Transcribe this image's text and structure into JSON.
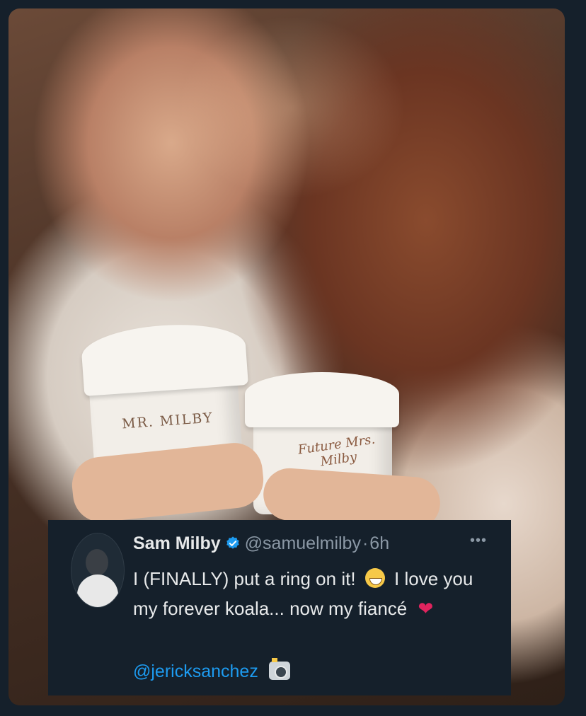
{
  "photo": {
    "cup_left_text": "MR. MILBY",
    "cup_right_text": "Future Mrs. Milby"
  },
  "tweet": {
    "author_name": "Sam Milby",
    "author_handle": "@samuelmilby",
    "separator": "·",
    "time": "6h",
    "more_label": "•••",
    "text_part1": "I (FINALLY) put a ring on it!",
    "text_part2": "I love you my forever koala... now my fiancé",
    "mention": "@jericksanchez",
    "colors": {
      "background": "#15202b",
      "link": "#1d9bf0",
      "verified": "#1d9bf0",
      "secondary_text": "#8b98a5"
    },
    "icons": {
      "verified": "verified-badge-icon",
      "grin": "grinning-face-emoji-icon",
      "heart": "red-heart-emoji-icon",
      "camera": "camera-flash-emoji-icon"
    }
  }
}
